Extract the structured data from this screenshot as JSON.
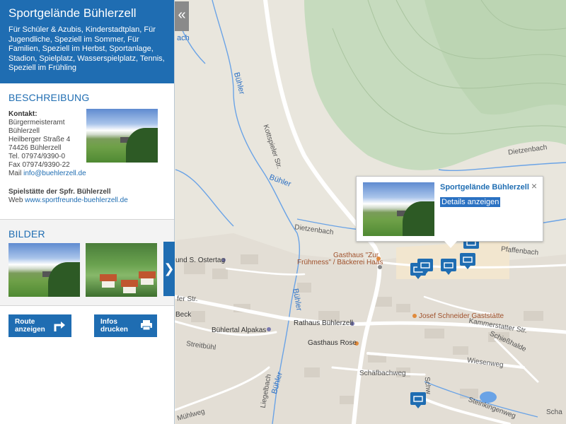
{
  "sidebar": {
    "title": "Sportgelände Bühlerzell",
    "tags": "Für Schüler & Azubis, Kinderstadtplan, Für Jugendliche, Speziell im Sommer, Für Familien, Speziell im Herbst, Sportanlage, Stadion, Spielplatz, Wasserspielplatz, Tennis, Speziell im Frühling",
    "collapse_glyph": "«",
    "description": {
      "heading": "BESCHREIBUNG",
      "contact_label": "Kontakt:",
      "contact_lines": [
        "Bürgermeisteramt",
        "Bühlerzell",
        "Heilberger Straße 4",
        "74426 Bühlerzell",
        "Tel. 07974/9390-0",
        "Fax 07974/9390-22"
      ],
      "mail_label": "Mail",
      "mail": "info@buehlerzell.de",
      "club_label": "Spielstätte der Spfr. Bühlerzell",
      "web_label": "Web",
      "web": "www.sportfreunde-buehlerzell.de"
    },
    "images": {
      "heading": "BILDER",
      "next_glyph": "❯"
    },
    "actions": {
      "route": [
        "Route",
        "anzeigen"
      ],
      "print": [
        "Infos",
        "drucken"
      ]
    }
  },
  "popup": {
    "title": "Sportgelände Bühlerzell",
    "details_link": "Details anzeigen",
    "close_glyph": "×"
  },
  "map": {
    "labels": {
      "kottspieler": "Kottspieler Str.",
      "dietzenbach1": "Dietzenbach",
      "dietzenbach2": "Dietzenbach",
      "pfaffenbach": "Pfaffenbach",
      "buehler1": "Bühler",
      "buehler2": "Bühler",
      "buehler3": "Bühler",
      "buehler4": "Bühler",
      "bach_top": "ach",
      "gasthaus_zur": "Gasthaus \"Zur",
      "fruehmess": "Frühmess\" / Bäckerei Haas",
      "ostertag": "und S. Ostertag",
      "schneider": "Josef Schneider Gaststätte",
      "rathaus": "Rathaus Bühlerzell",
      "kammerstatter": "Kammerstatter Str.",
      "alpakas": "Bühlertal Alpakas",
      "beck": "Beck",
      "gasthaus_rose": "Gasthaus Rose",
      "streitbuehl": "Streitbühl",
      "schiesshalde": "Schießhalde",
      "wiesenweg": "Wiesenweg",
      "schaefbachweg": "Schäfbachweg",
      "liegelbach": "Liegelbach",
      "steinkingenweg": "Steinkingenweg",
      "muehlweg": "Mühlweg",
      "schw": "Schw",
      "sch": "Scha",
      "fer_str": "fer Str."
    }
  },
  "colors": {
    "accent": "#1f6db2",
    "forest": "#c8dcc0",
    "water": "#5b9ae0",
    "settlement": "#e2ddd4"
  }
}
